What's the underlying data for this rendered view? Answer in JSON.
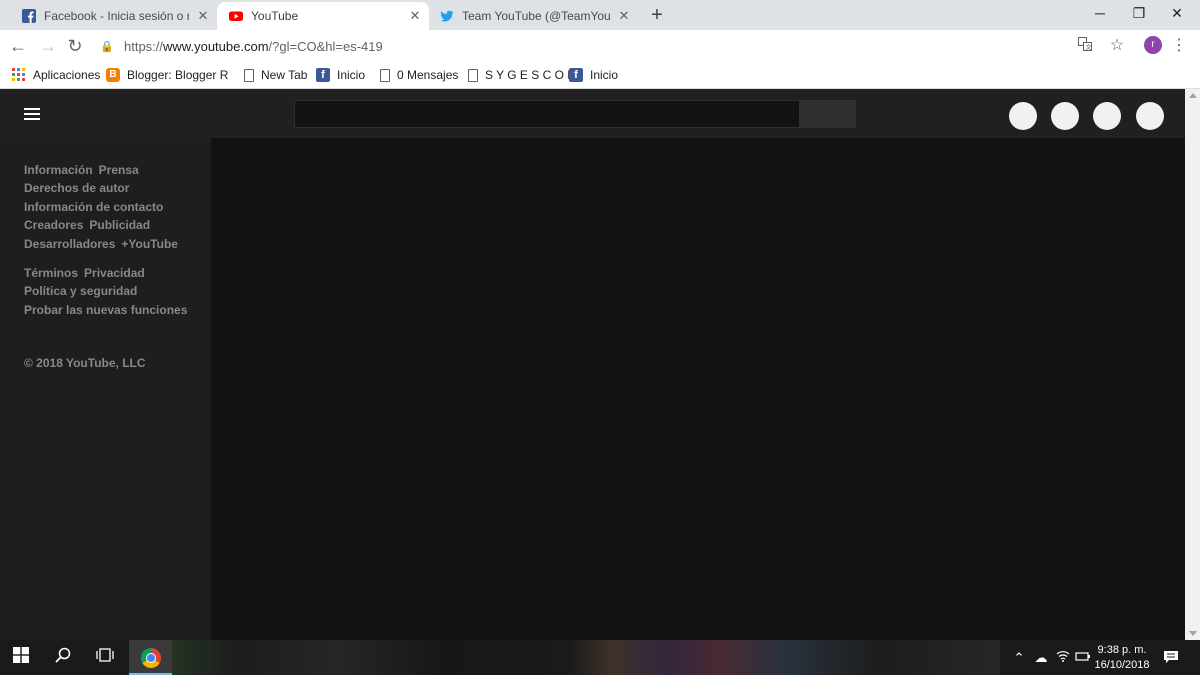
{
  "browser": {
    "tabs": [
      {
        "title": "Facebook - Inicia sesión o regístrate",
        "favicon": "facebook-icon",
        "active": false
      },
      {
        "title": "YouTube",
        "favicon": "youtube-icon",
        "active": true
      },
      {
        "title": "Team YouTube (@TeamYouTube) | Twitter",
        "favicon": "twitter-icon",
        "active": false
      }
    ],
    "new_tab": "+",
    "url": {
      "scheme": "https://",
      "host": "www.youtube.com",
      "path": "/?gl=CO&hl=es-419"
    },
    "profile_initial": "r",
    "bookmarks": [
      {
        "label": "Aplicaciones",
        "icon": "apps-grid-icon"
      },
      {
        "label": "Blogger: Blogger Rog",
        "icon": "blogger-icon"
      },
      {
        "label": "New Tab",
        "icon": "page-icon"
      },
      {
        "label": "Inicio",
        "icon": "facebook-icon"
      },
      {
        "label": "0 Mensajes",
        "icon": "page-icon"
      },
      {
        "label": "S Y G E S C O L",
        "icon": "page-icon"
      },
      {
        "label": "Inicio",
        "icon": "facebook-icon"
      }
    ]
  },
  "youtube": {
    "footer_groups": [
      [
        [
          "Información",
          "Prensa"
        ],
        [
          "Derechos de autor"
        ],
        [
          "Información de contacto"
        ],
        [
          "Creadores",
          "Publicidad"
        ],
        [
          "Desarrolladores",
          "+YouTube"
        ]
      ],
      [
        [
          "Términos",
          "Privacidad"
        ],
        [
          "Política y seguridad"
        ],
        [
          "Probar las nuevas funciones"
        ]
      ]
    ],
    "copyright": "© 2018 YouTube, LLC"
  },
  "taskbar": {
    "time": "9:38 p. m.",
    "date": "16/10/2018"
  },
  "colors": {
    "youtube_header": "#202020",
    "youtube_sidebar": "#1e1e1e",
    "youtube_content": "#121212",
    "facebook": "#3b5998",
    "youtube_red": "#ff0000",
    "twitter": "#1da1f2"
  }
}
